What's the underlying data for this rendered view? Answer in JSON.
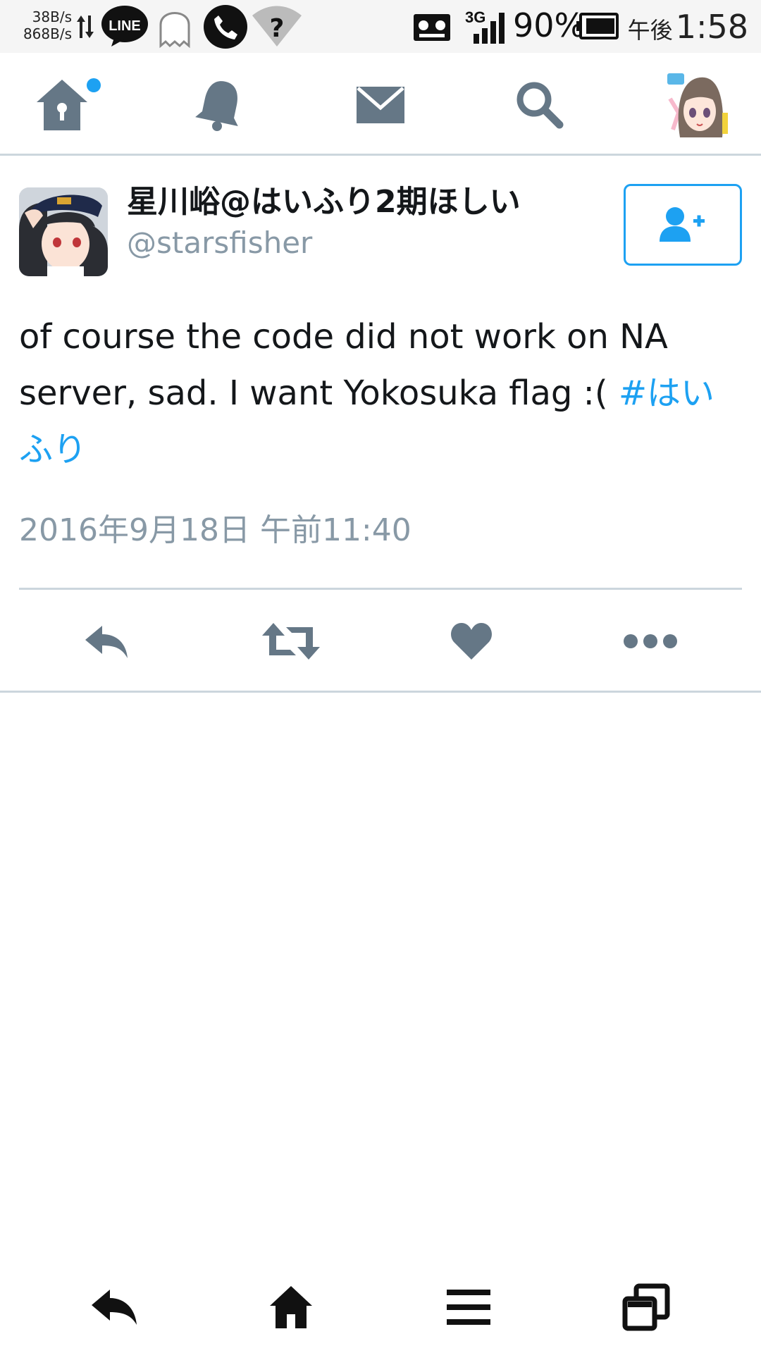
{
  "status_bar": {
    "net_up": "38B/s",
    "net_down": "868B/s",
    "line_label": "LINE",
    "network_type": "3G",
    "battery_pct": "90%",
    "time_prefix": "午後",
    "time": "1:58",
    "icons": [
      "data-arrows-icon",
      "line-app-icon",
      "ghost-icon",
      "phone-call-icon",
      "wifi-unknown-icon",
      "voicemail-icon",
      "signal-icon",
      "battery-icon"
    ]
  },
  "top_nav": {
    "items": [
      "home-icon",
      "notifications-icon",
      "messages-icon",
      "search-icon",
      "profile-avatar"
    ],
    "home_has_new": true
  },
  "tweet": {
    "display_name": "星川峪@はいふり2期ほしい",
    "handle": "@starsfisher",
    "text": "of course the code did not work on NA server, sad. I want Yokosuka flag :( ",
    "hashtag": "#はいふり",
    "timestamp": "2016年9月18日 午前11:40"
  },
  "actions": [
    "reply-icon",
    "retweet-icon",
    "like-icon",
    "more-icon"
  ],
  "colors": {
    "accent": "#1da1f2",
    "icon_gray": "#657786",
    "text_primary": "#14171a",
    "text_secondary": "#8899a6",
    "divider": "#ccd6dd"
  },
  "system_nav": [
    "back-icon",
    "home-icon",
    "menu-icon",
    "recents-icon"
  ]
}
